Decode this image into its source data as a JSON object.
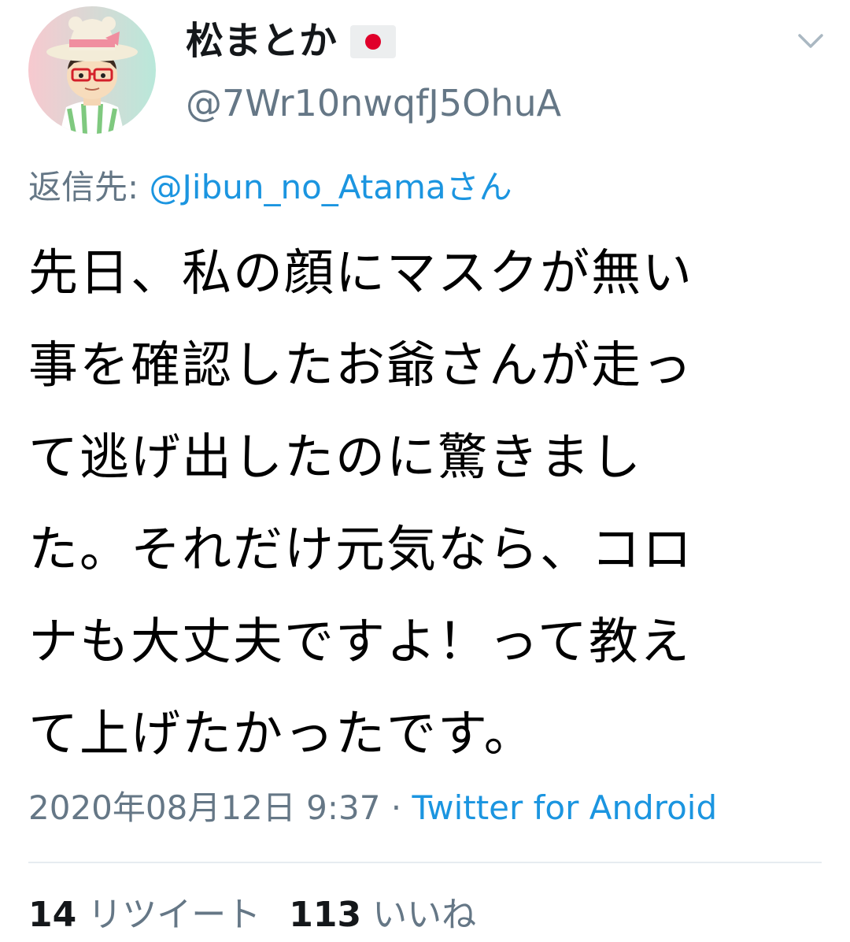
{
  "author": {
    "display_name": "松まとか",
    "handle": "@7Wr10nwqfJ5OhuA",
    "avatar_icon": "cartoon-avatar-icon",
    "flag_icon": "japan-flag-icon"
  },
  "menu_icon": "chevron-down-icon",
  "reply": {
    "prefix": "返信先: ",
    "mention": "@Jibun_no_Atamaさん"
  },
  "tweet": {
    "lines": [
      "先日、私の顔にマスクが無い",
      "事を確認したお爺さんが走っ",
      "て逃げ出したのに驚きまし",
      "た。それだけ元気なら、コロ",
      "ナも大丈夫ですよ！って教え",
      "て上げたかったです。"
    ]
  },
  "meta": {
    "timestamp": "2020年08月12日 9:37",
    "separator": " · ",
    "source": "Twitter for Android"
  },
  "stats": {
    "retweet_count": "14",
    "retweet_label": "リツイート",
    "like_count": "113",
    "like_label": "いいね"
  },
  "colors": {
    "link": "#1b95e0",
    "secondary_text": "#657786",
    "primary_text": "#14171a",
    "flag_red": "#e0002a",
    "divider": "#e6ecf0"
  }
}
